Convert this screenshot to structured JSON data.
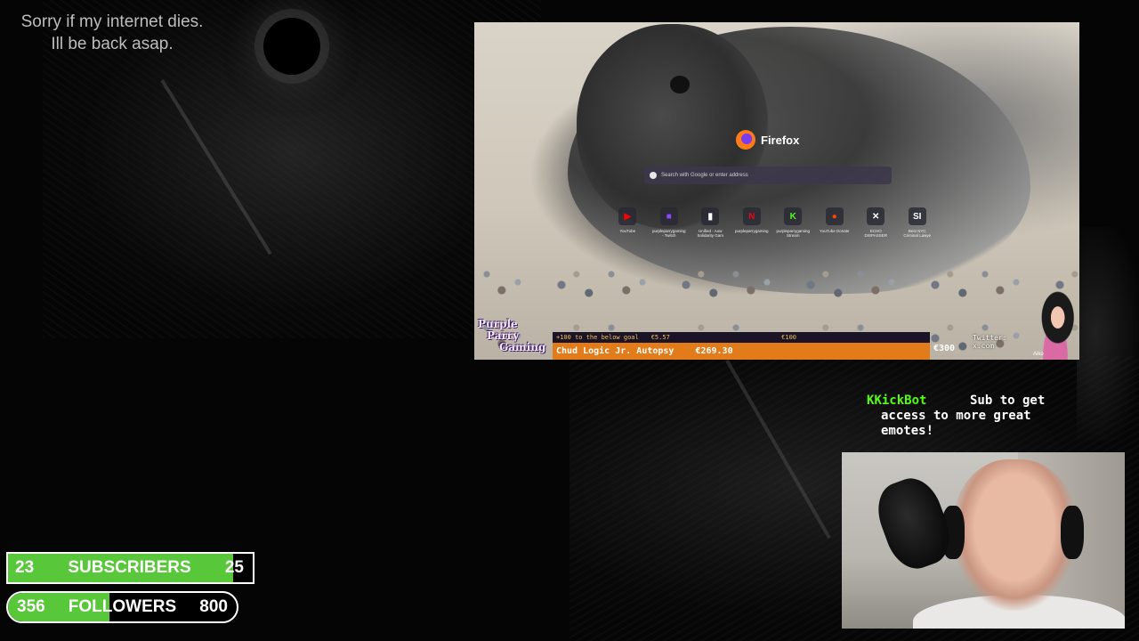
{
  "status_note": {
    "line1": "Sorry if my internet dies.",
    "line2": "Ill be back asap."
  },
  "browser": {
    "brand": "Firefox",
    "search_placeholder": "Search with Google or enter address",
    "shortcuts": [
      {
        "label": "YouTube",
        "icon": "youtube-icon",
        "glyph": "▶",
        "color": "#ff0000"
      },
      {
        "label": "purpleparrygaming - Twitch",
        "icon": "twitch-icon",
        "glyph": "■",
        "color": "#9146ff"
      },
      {
        "label": "Unified - Aow Solidarity Gam",
        "icon": "unified-icon",
        "glyph": "▮",
        "color": "#ffffff"
      },
      {
        "label": "purpleparrygaming",
        "icon": "netflix-icon",
        "glyph": "N",
        "color": "#e50914"
      },
      {
        "label": "purpleparrygaming Stream",
        "icon": "kick-icon",
        "glyph": "K",
        "color": "#53fc18"
      },
      {
        "label": "YouTube Donate",
        "icon": "reddit-icon",
        "glyph": "●",
        "color": "#ff4500"
      },
      {
        "label": "ECHO DISPASSER",
        "icon": "x-icon",
        "glyph": "✕",
        "color": "#ffffff"
      },
      {
        "label": "Best NYC Criminal Lawye",
        "icon": "si-icon",
        "glyph": "SI",
        "color": "#ffffff"
      }
    ]
  },
  "overlay": {
    "channel_logo": {
      "line1": "Purple",
      "line2": "Parry",
      "line3": "Gaming"
    },
    "donation": {
      "top_text": "+100 to the below goal",
      "top_amount": "€5.57",
      "top_goal": "€100",
      "title": "Chud Logic Jr. Autopsy",
      "amount": "€269.30",
      "goal": "€300"
    },
    "twitter_label": "Twitter:",
    "twitter_handle": "x.com",
    "vtuber_name": "Aiko"
  },
  "chat": {
    "badge": "K",
    "username": "KickBot",
    "message": "Sub to get access to more great emotes!"
  },
  "goals": {
    "subscribers": {
      "current": "23",
      "label": "SUBSCRIBERS",
      "target": "25",
      "progress": 0.92
    },
    "followers": {
      "current": "356",
      "label": "FOLLOWERS",
      "target": "800",
      "progress": 0.445
    }
  }
}
